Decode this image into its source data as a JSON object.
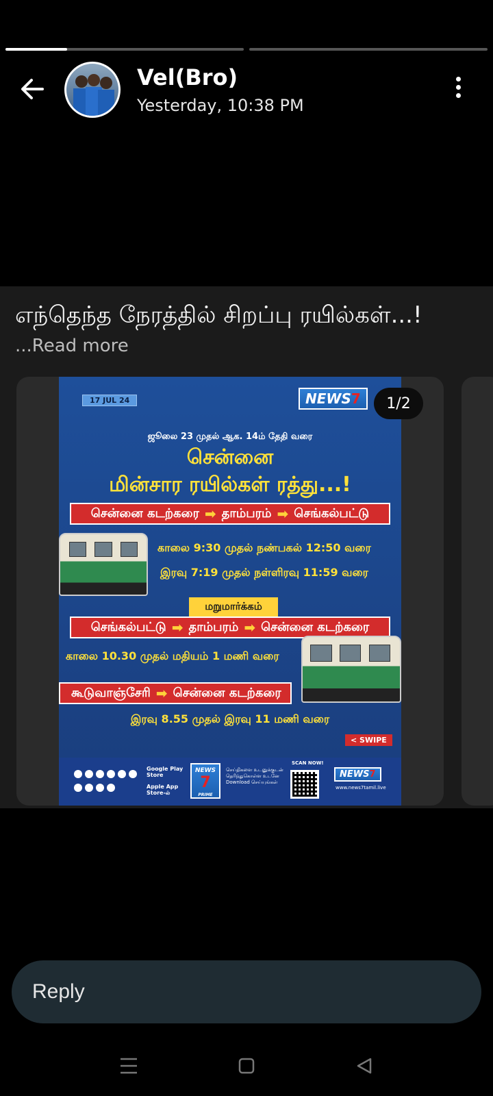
{
  "header": {
    "name": "Vel(Bro)",
    "time": "Yesterday, 10:38 PM",
    "progress": [
      1,
      0
    ]
  },
  "caption": {
    "text": "எந்தெந்த நேரத்தில் சிறப்பு ரயில்கள்...!",
    "read_more": "...Read more"
  },
  "media": {
    "counter": "1/2",
    "poster": {
      "date": "17 JUL 24",
      "logo": "NEWS",
      "logo_num": "7",
      "subtitle": "ஜூலை 23 முதல் ஆக. 14ம் தேதி வரை",
      "title_line1": "சென்னை",
      "title_line2": "மின்சார ரயில்கள் ரத்து...!",
      "route1": [
        "சென்னை கடற்கரை",
        "தாம்பரம்",
        "செங்கல்பட்டு"
      ],
      "route1_time1": "காலை 9:30 முதல் நண்பகல் 12:50 வரை",
      "route1_time2": "இரவு 7:19 முதல் நள்ளிரவு 11:59 வரை",
      "alt_label": "மறுமார்க்கம்",
      "route2": [
        "செங்கல்பட்டு",
        "தாம்பரம்",
        "சென்னை கடற்கரை"
      ],
      "route2_time": "காலை 10.30 முதல் மதியம் 1 மணி வரை",
      "route3": [
        "கூடுவாஞ்சேரி",
        "சென்னை கடற்கரை"
      ],
      "route3_time": "இரவு 8.55 முதல் இரவு 11 மணி வரை",
      "swipe": "< SWIPE",
      "footer": {
        "google": "Google Play Store",
        "apple": "Apple App Store-ல்",
        "prime": "PRIME",
        "info": "செய்திகளை உடனுக்குடன் தெரிந்துகொள்ள உடனே Download செய்யுங்கள்",
        "scan": "SCAN NOW!",
        "url": "www.news7tamil.live"
      }
    }
  },
  "reply": {
    "placeholder": "Reply"
  }
}
